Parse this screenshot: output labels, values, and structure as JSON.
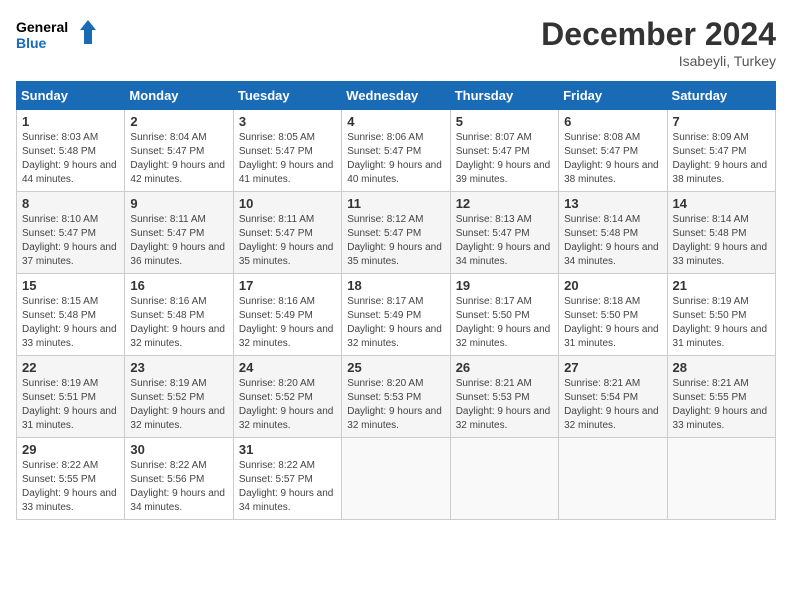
{
  "logo": {
    "line1": "General",
    "line2": "Blue"
  },
  "title": "December 2024",
  "location": "Isabeyli, Turkey",
  "headers": [
    "Sunday",
    "Monday",
    "Tuesday",
    "Wednesday",
    "Thursday",
    "Friday",
    "Saturday"
  ],
  "weeks": [
    [
      {
        "day": "1",
        "sunrise": "8:03 AM",
        "sunset": "5:48 PM",
        "daylight": "9 hours and 44 minutes."
      },
      {
        "day": "2",
        "sunrise": "8:04 AM",
        "sunset": "5:47 PM",
        "daylight": "9 hours and 42 minutes."
      },
      {
        "day": "3",
        "sunrise": "8:05 AM",
        "sunset": "5:47 PM",
        "daylight": "9 hours and 41 minutes."
      },
      {
        "day": "4",
        "sunrise": "8:06 AM",
        "sunset": "5:47 PM",
        "daylight": "9 hours and 40 minutes."
      },
      {
        "day": "5",
        "sunrise": "8:07 AM",
        "sunset": "5:47 PM",
        "daylight": "9 hours and 39 minutes."
      },
      {
        "day": "6",
        "sunrise": "8:08 AM",
        "sunset": "5:47 PM",
        "daylight": "9 hours and 38 minutes."
      },
      {
        "day": "7",
        "sunrise": "8:09 AM",
        "sunset": "5:47 PM",
        "daylight": "9 hours and 38 minutes."
      }
    ],
    [
      {
        "day": "8",
        "sunrise": "8:10 AM",
        "sunset": "5:47 PM",
        "daylight": "9 hours and 37 minutes."
      },
      {
        "day": "9",
        "sunrise": "8:11 AM",
        "sunset": "5:47 PM",
        "daylight": "9 hours and 36 minutes."
      },
      {
        "day": "10",
        "sunrise": "8:11 AM",
        "sunset": "5:47 PM",
        "daylight": "9 hours and 35 minutes."
      },
      {
        "day": "11",
        "sunrise": "8:12 AM",
        "sunset": "5:47 PM",
        "daylight": "9 hours and 35 minutes."
      },
      {
        "day": "12",
        "sunrise": "8:13 AM",
        "sunset": "5:47 PM",
        "daylight": "9 hours and 34 minutes."
      },
      {
        "day": "13",
        "sunrise": "8:14 AM",
        "sunset": "5:48 PM",
        "daylight": "9 hours and 34 minutes."
      },
      {
        "day": "14",
        "sunrise": "8:14 AM",
        "sunset": "5:48 PM",
        "daylight": "9 hours and 33 minutes."
      }
    ],
    [
      {
        "day": "15",
        "sunrise": "8:15 AM",
        "sunset": "5:48 PM",
        "daylight": "9 hours and 33 minutes."
      },
      {
        "day": "16",
        "sunrise": "8:16 AM",
        "sunset": "5:48 PM",
        "daylight": "9 hours and 32 minutes."
      },
      {
        "day": "17",
        "sunrise": "8:16 AM",
        "sunset": "5:49 PM",
        "daylight": "9 hours and 32 minutes."
      },
      {
        "day": "18",
        "sunrise": "8:17 AM",
        "sunset": "5:49 PM",
        "daylight": "9 hours and 32 minutes."
      },
      {
        "day": "19",
        "sunrise": "8:17 AM",
        "sunset": "5:50 PM",
        "daylight": "9 hours and 32 minutes."
      },
      {
        "day": "20",
        "sunrise": "8:18 AM",
        "sunset": "5:50 PM",
        "daylight": "9 hours and 31 minutes."
      },
      {
        "day": "21",
        "sunrise": "8:19 AM",
        "sunset": "5:50 PM",
        "daylight": "9 hours and 31 minutes."
      }
    ],
    [
      {
        "day": "22",
        "sunrise": "8:19 AM",
        "sunset": "5:51 PM",
        "daylight": "9 hours and 31 minutes."
      },
      {
        "day": "23",
        "sunrise": "8:19 AM",
        "sunset": "5:52 PM",
        "daylight": "9 hours and 32 minutes."
      },
      {
        "day": "24",
        "sunrise": "8:20 AM",
        "sunset": "5:52 PM",
        "daylight": "9 hours and 32 minutes."
      },
      {
        "day": "25",
        "sunrise": "8:20 AM",
        "sunset": "5:53 PM",
        "daylight": "9 hours and 32 minutes."
      },
      {
        "day": "26",
        "sunrise": "8:21 AM",
        "sunset": "5:53 PM",
        "daylight": "9 hours and 32 minutes."
      },
      {
        "day": "27",
        "sunrise": "8:21 AM",
        "sunset": "5:54 PM",
        "daylight": "9 hours and 32 minutes."
      },
      {
        "day": "28",
        "sunrise": "8:21 AM",
        "sunset": "5:55 PM",
        "daylight": "9 hours and 33 minutes."
      }
    ],
    [
      {
        "day": "29",
        "sunrise": "8:22 AM",
        "sunset": "5:55 PM",
        "daylight": "9 hours and 33 minutes."
      },
      {
        "day": "30",
        "sunrise": "8:22 AM",
        "sunset": "5:56 PM",
        "daylight": "9 hours and 34 minutes."
      },
      {
        "day": "31",
        "sunrise": "8:22 AM",
        "sunset": "5:57 PM",
        "daylight": "9 hours and 34 minutes."
      },
      null,
      null,
      null,
      null
    ]
  ]
}
